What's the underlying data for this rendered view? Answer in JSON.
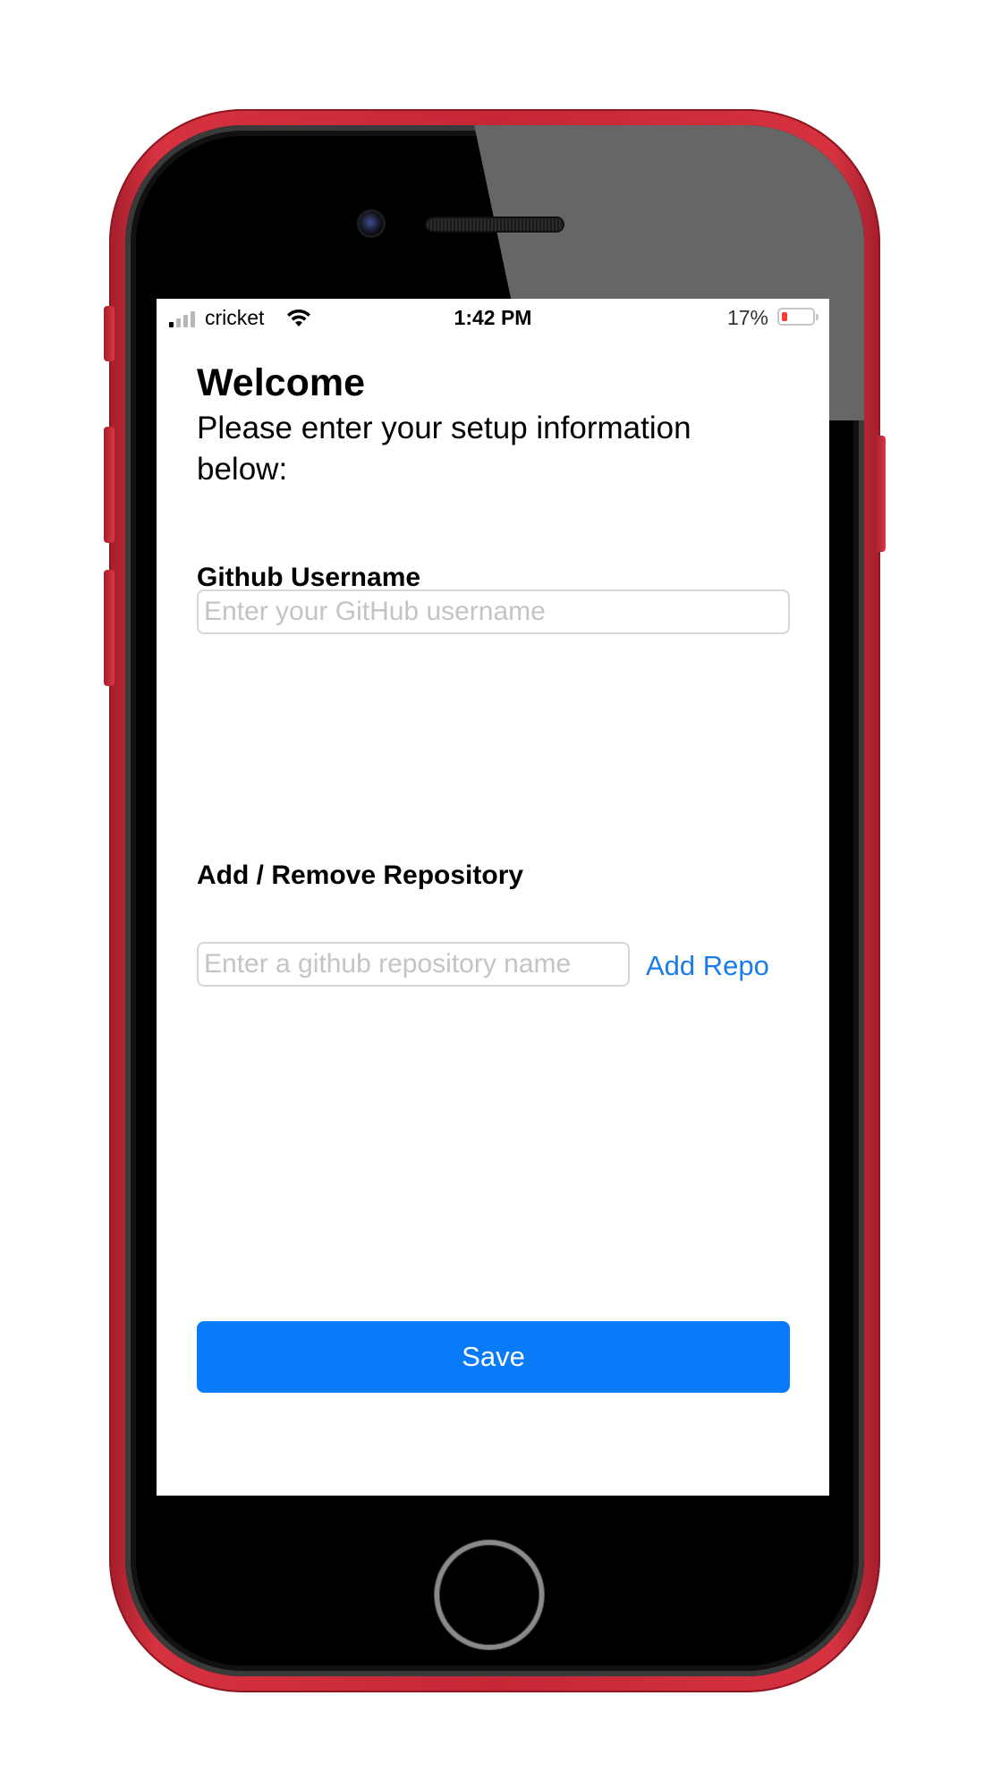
{
  "status_bar": {
    "carrier": "cricket",
    "time": "1:42 PM",
    "battery_percent": "17%",
    "battery_level": 0.17,
    "signal_bars_active": 1,
    "signal_bars_total": 4
  },
  "header": {
    "title": "Welcome",
    "subtitle": "Please enter your setup information below:"
  },
  "github_username": {
    "label": "Github Username",
    "placeholder": "Enter your GitHub username",
    "value": ""
  },
  "repository": {
    "label": "Add / Remove Repository",
    "placeholder": "Enter a github repository name",
    "value": "",
    "add_label": "Add Repo"
  },
  "save_label": "Save",
  "colors": {
    "accent": "#087bfb",
    "link": "#1a7ce8",
    "device": "#c52736"
  }
}
